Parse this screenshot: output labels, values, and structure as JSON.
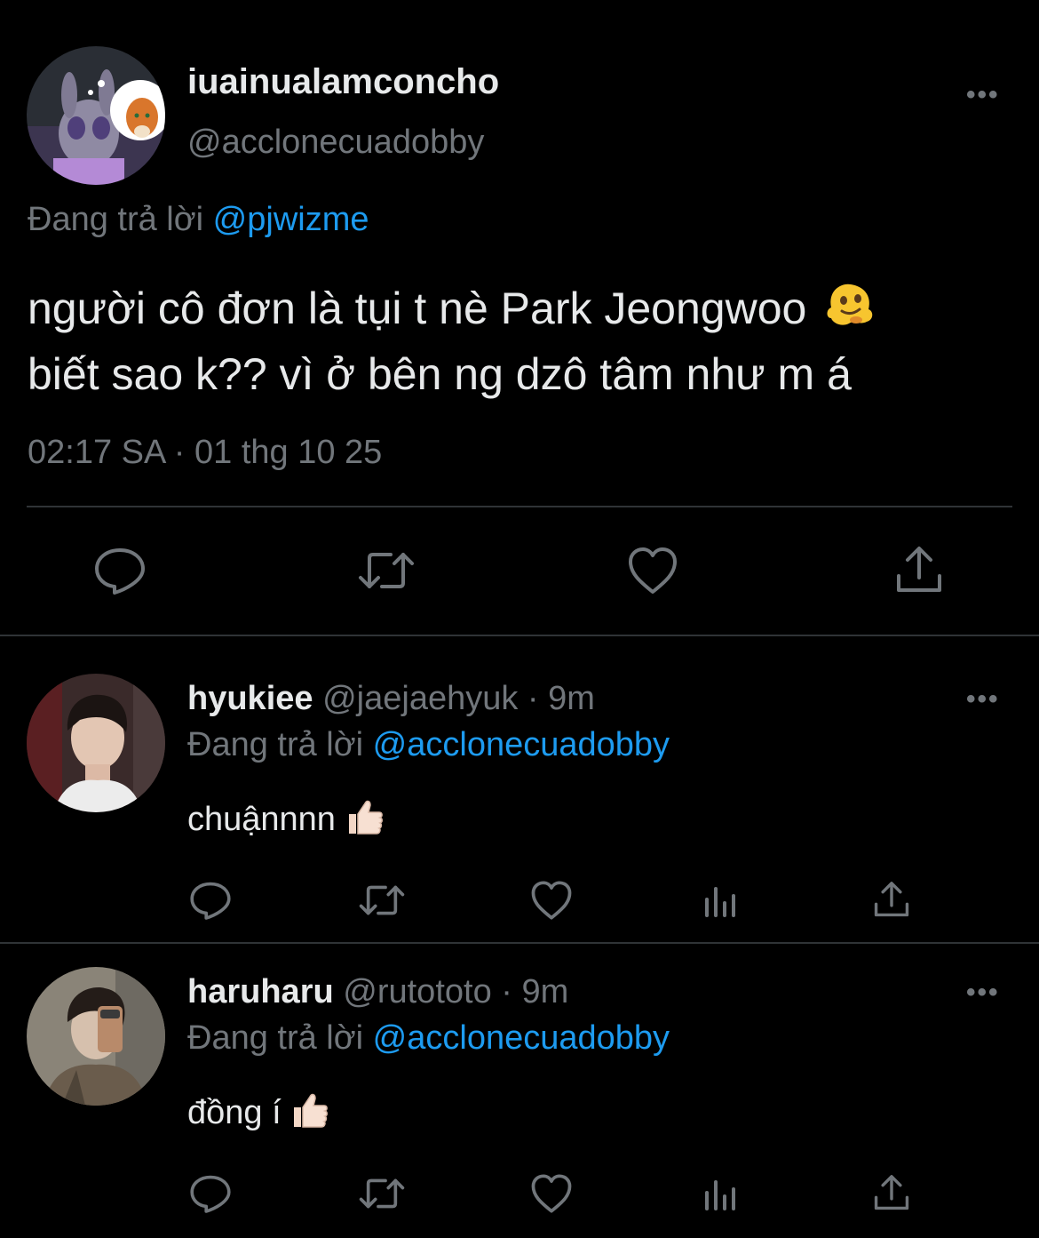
{
  "main_tweet": {
    "display_name": "iuainualamconcho",
    "handle": "@acclonecuadobby",
    "reply_prefix": "Đang trả lời",
    "reply_to": "@pjwizme",
    "text_line1": "người cô đơn là tụi t nè Park Jeongwoo",
    "text_line2": "biết sao k?? vì ở bên ng dzô tâm như m á",
    "emoji_icon": "melting-face-emoji",
    "timestamp": "02:17 SA · 01 thg 10 25",
    "more_label": "•••"
  },
  "replies": [
    {
      "display_name": "hyukiee",
      "handle": "@jaejaehyuk",
      "age": "· 9m",
      "reply_prefix": "Đang trả lời",
      "reply_to": "@acclonecuadobby",
      "text": "chuậnnnn",
      "emoji_icon": "thumbs-up-emoji",
      "more_label": "•••"
    },
    {
      "display_name": "haruharu",
      "handle": "@rutototo",
      "age": "· 9m",
      "reply_prefix": "Đang trả lời",
      "reply_to": "@acclonecuadobby",
      "text": "đồng í",
      "emoji_icon": "thumbs-up-emoji",
      "more_label": "•••"
    }
  ],
  "colors": {
    "background": "#000000",
    "text": "#e7e9ea",
    "muted": "#71767b",
    "link": "#1d9bf0",
    "divider": "#2f3336"
  }
}
